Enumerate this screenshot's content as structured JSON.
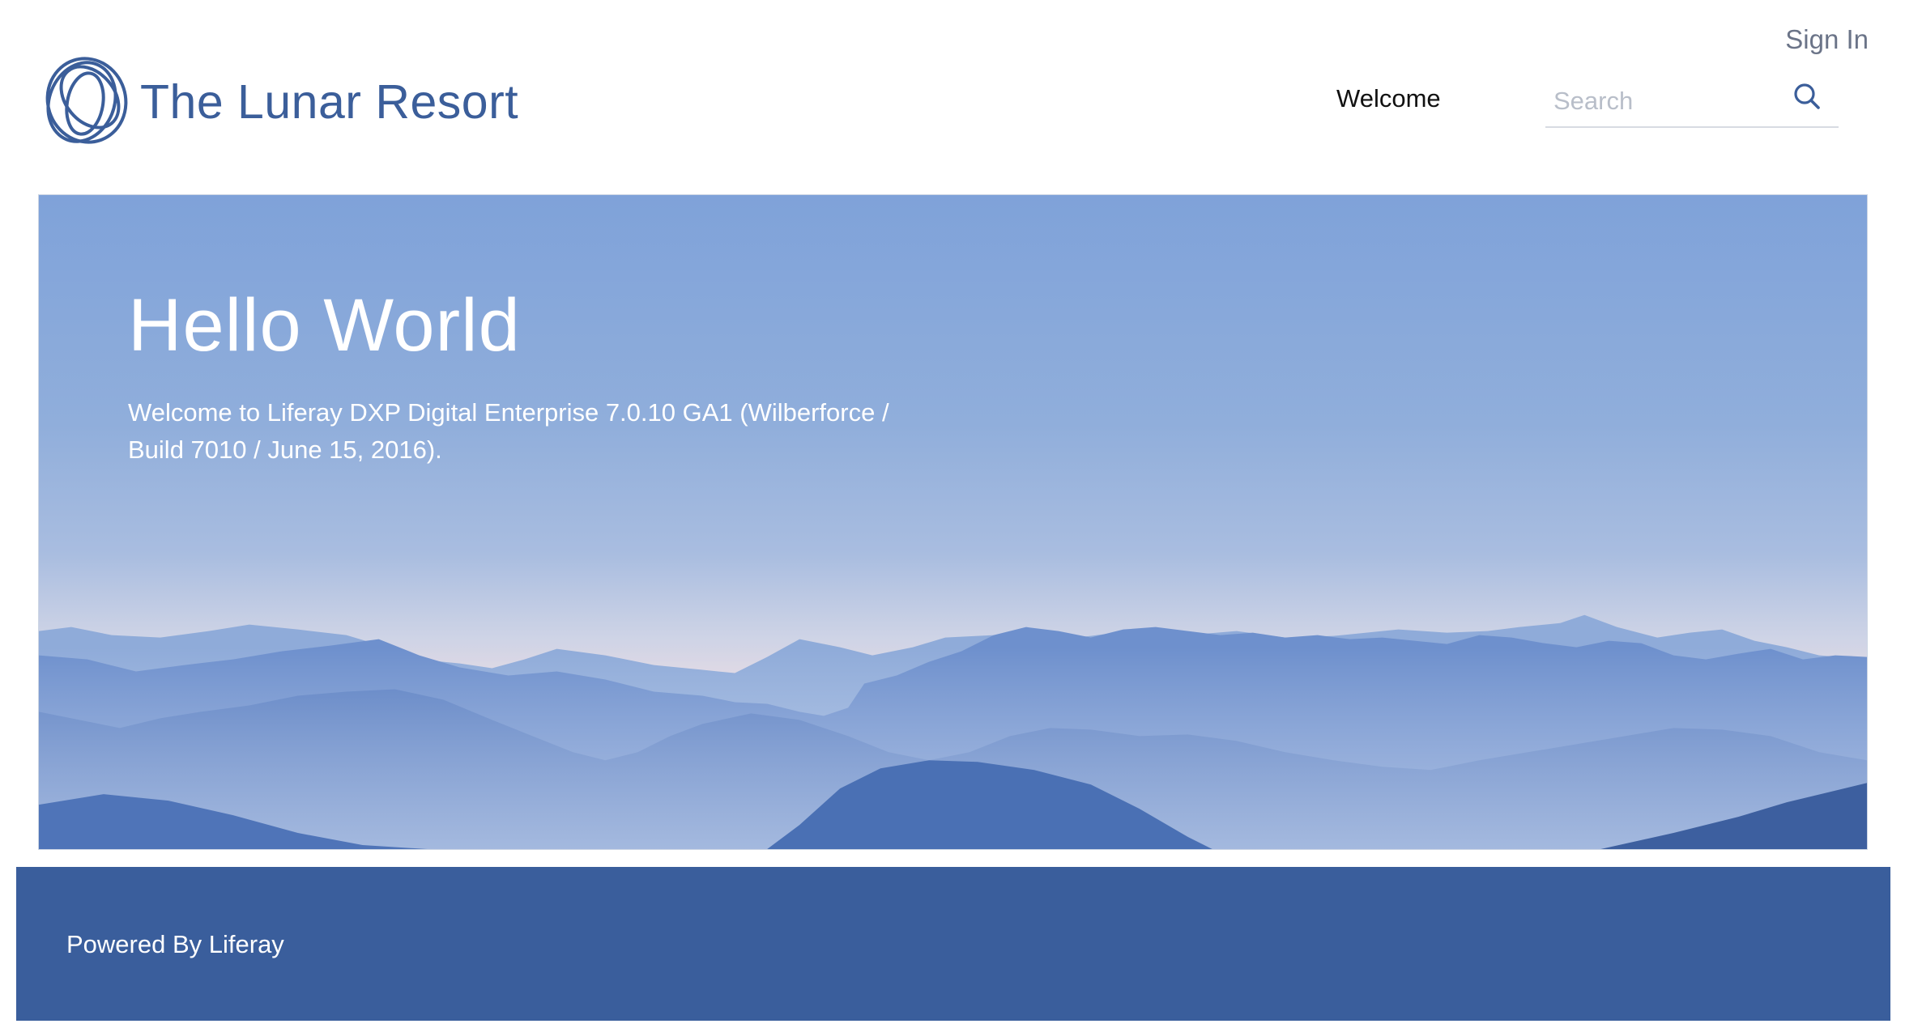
{
  "header": {
    "site_name": "The Lunar Resort",
    "sign_in": "Sign In",
    "nav": [
      {
        "label": "Welcome"
      }
    ],
    "search": {
      "placeholder": "Search",
      "value": ""
    }
  },
  "hero": {
    "title": "Hello World",
    "text": "Welcome to Liferay DXP Digital Enterprise 7.0.10 GA1 (Wilberforce / Build 7010 / June 15, 2016)."
  },
  "footer": {
    "powered_by": "Powered By",
    "liferay_link": "Liferay"
  },
  "colors": {
    "brand": "#3b5e9a",
    "footer_bg": "#3a5e9c",
    "sky_top": "#80a3d8",
    "mountains": "#4f78bc"
  },
  "icons": {
    "logo": "lunar-rings-logo",
    "search": "search-icon"
  }
}
